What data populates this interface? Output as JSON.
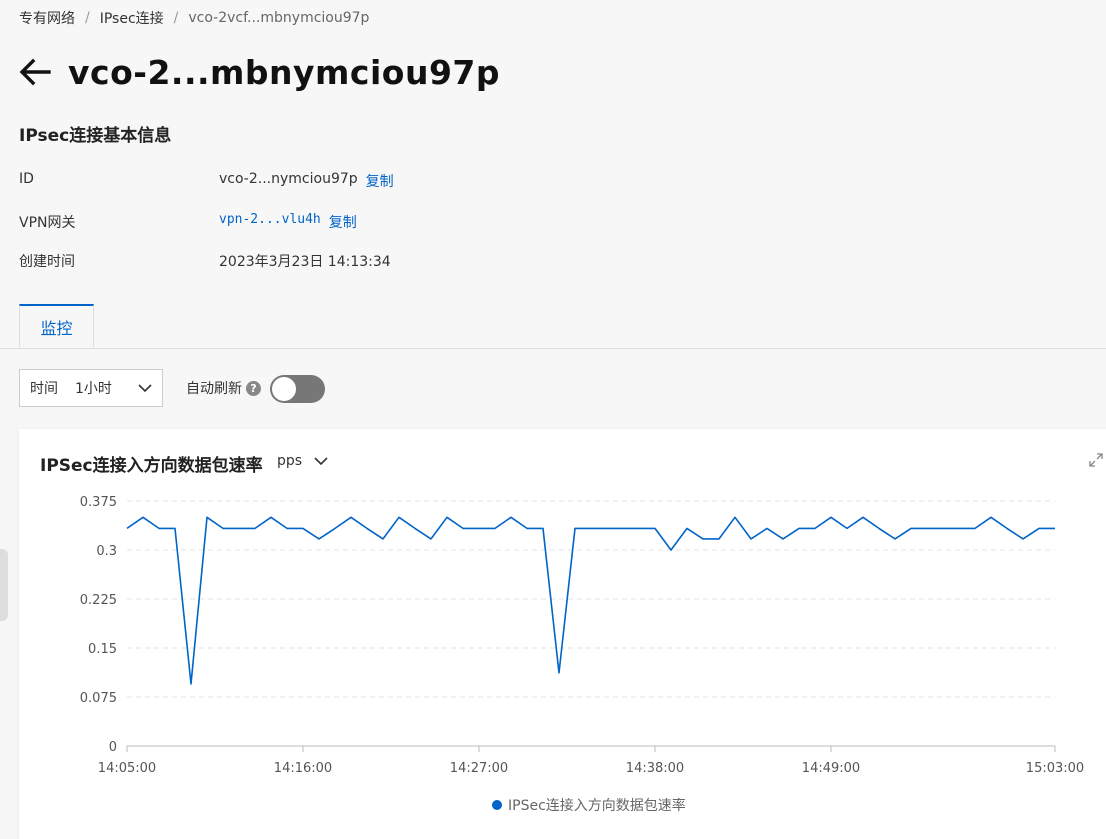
{
  "breadcrumb": {
    "items": [
      "专有网络",
      "IPsec连接"
    ],
    "current": "vco-2vcf...mbnymciou97p"
  },
  "page": {
    "title": "vco-2...mbnymciou97p"
  },
  "basic_info": {
    "title": "IPsec连接基本信息",
    "id_label": "ID",
    "id_value": "vco-2...nymciou97p",
    "vpn_label": "VPN网关",
    "vpn_value": "vpn-2...vlu4h",
    "created_label": "创建时间",
    "created_value": "2023年3月23日 14:13:34",
    "copy_label": "复制"
  },
  "tabs": [
    {
      "label": "监控"
    }
  ],
  "controls": {
    "time_label": "时间",
    "time_value": "1小时",
    "auto_refresh_label": "自动刷新",
    "help_glyph": "?"
  },
  "chart_card": {
    "title": "IPSec连接入方向数据包速率",
    "unit": "pps"
  },
  "chart_data": {
    "type": "line",
    "title": "IPSec连接入方向数据包速率",
    "xlabel": "",
    "ylabel": "",
    "ylim": [
      0,
      0.375
    ],
    "yticks": [
      "0.375",
      "0.3",
      "0.225",
      "0.15",
      "0.075",
      "0"
    ],
    "xticks": [
      "14:05:00",
      "14:16:00",
      "14:27:00",
      "14:38:00",
      "14:49:00",
      "15:03:00"
    ],
    "x_range": [
      "14:05:00",
      "15:03:00"
    ],
    "grid": true,
    "legend": "bottom",
    "color": "#0064c8",
    "series": [
      {
        "name": "IPSec连接入方向数据包速率",
        "points": [
          [
            "14:05:00",
            0.333
          ],
          [
            "14:06:00",
            0.35
          ],
          [
            "14:07:00",
            0.333
          ],
          [
            "14:08:00",
            0.333
          ],
          [
            "14:09:00",
            0.095
          ],
          [
            "14:10:00",
            0.35
          ],
          [
            "14:11:00",
            0.333
          ],
          [
            "14:12:00",
            0.333
          ],
          [
            "14:13:00",
            0.333
          ],
          [
            "14:14:00",
            0.35
          ],
          [
            "14:15:00",
            0.333
          ],
          [
            "14:16:00",
            0.333
          ],
          [
            "14:17:00",
            0.317
          ],
          [
            "14:18:00",
            0.333
          ],
          [
            "14:19:00",
            0.35
          ],
          [
            "14:20:00",
            0.333
          ],
          [
            "14:21:00",
            0.317
          ],
          [
            "14:22:00",
            0.35
          ],
          [
            "14:23:00",
            0.333
          ],
          [
            "14:24:00",
            0.317
          ],
          [
            "14:25:00",
            0.35
          ],
          [
            "14:26:00",
            0.333
          ],
          [
            "14:27:00",
            0.333
          ],
          [
            "14:28:00",
            0.333
          ],
          [
            "14:29:00",
            0.35
          ],
          [
            "14:30:00",
            0.333
          ],
          [
            "14:31:00",
            0.333
          ],
          [
            "14:32:00",
            0.112
          ],
          [
            "14:33:00",
            0.333
          ],
          [
            "14:34:00",
            0.333
          ],
          [
            "14:35:00",
            0.333
          ],
          [
            "14:36:00",
            0.333
          ],
          [
            "14:37:00",
            0.333
          ],
          [
            "14:38:00",
            0.333
          ],
          [
            "14:39:00",
            0.3
          ],
          [
            "14:40:00",
            0.333
          ],
          [
            "14:41:00",
            0.317
          ],
          [
            "14:42:00",
            0.317
          ],
          [
            "14:43:00",
            0.35
          ],
          [
            "14:44:00",
            0.317
          ],
          [
            "14:45:00",
            0.333
          ],
          [
            "14:46:00",
            0.317
          ],
          [
            "14:47:00",
            0.333
          ],
          [
            "14:48:00",
            0.333
          ],
          [
            "14:49:00",
            0.35
          ],
          [
            "14:50:00",
            0.333
          ],
          [
            "14:51:00",
            0.35
          ],
          [
            "14:52:00",
            0.333
          ],
          [
            "14:53:00",
            0.317
          ],
          [
            "14:54:00",
            0.333
          ],
          [
            "14:55:00",
            0.333
          ],
          [
            "14:56:00",
            0.333
          ],
          [
            "14:57:00",
            0.333
          ],
          [
            "14:58:00",
            0.333
          ],
          [
            "14:59:00",
            0.35
          ],
          [
            "15:00:00",
            0.333
          ],
          [
            "15:01:00",
            0.317
          ],
          [
            "15:02:00",
            0.333
          ],
          [
            "15:03:00",
            0.333
          ]
        ]
      }
    ]
  }
}
